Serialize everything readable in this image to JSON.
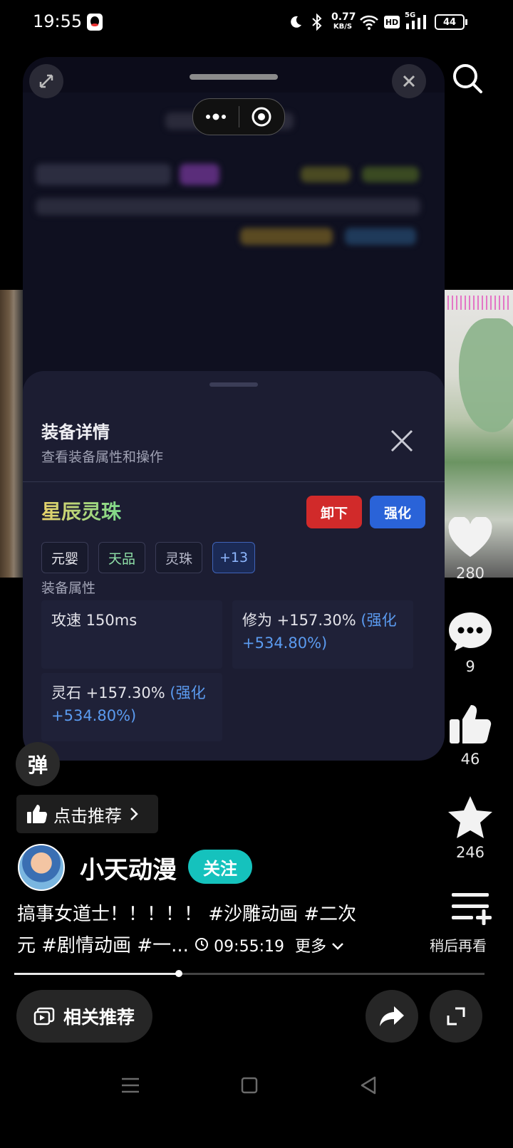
{
  "status_bar": {
    "time": "19:55",
    "network_speed_value": "0.77",
    "network_speed_unit": "KB/S",
    "hd_label": "HD",
    "cell_label": "5G",
    "battery": "44",
    "icons": [
      "qq-icon",
      "moon-icon",
      "bluetooth-icon",
      "wifi-icon",
      "hd-icon",
      "signal-icon",
      "battery-icon"
    ]
  },
  "mini_program": {
    "capsule_icons": [
      "more-dots-icon",
      "target-icon"
    ],
    "sheet": {
      "title": "装备详情",
      "subtitle": "查看装备属性和操作",
      "item_name": "星辰灵珠",
      "unequip_label": "卸下",
      "enhance_label": "强化",
      "tags": [
        {
          "text": "元婴",
          "color": "#e8e8ee"
        },
        {
          "text": "天品",
          "color": "#8fe0a8"
        },
        {
          "text": "灵珠",
          "color": "#b8bacb"
        },
        {
          "text": "+13",
          "color": "#8fb8ff"
        }
      ],
      "attributes_label": "装备属性",
      "attributes": [
        {
          "text": "攻速 150ms",
          "bonus": ""
        },
        {
          "text": "修为 +157.30%",
          "bonus": " (强化 +534.80%)"
        },
        {
          "text": "灵石 +157.30%",
          "bonus": " (强化 +534.80%)"
        }
      ]
    }
  },
  "right_rail": {
    "likes_heart": "280",
    "comments": "9",
    "thumbs": "46",
    "favorites": "246",
    "watch_later": "稍后再看"
  },
  "video_info": {
    "danmu_label": "弹",
    "recommend_label": "点击推荐",
    "author": "小天动漫",
    "follow_label": "关注",
    "description": "搞事女道士！！！！！ #沙雕动画 #二次元 #剧情动画 #一...",
    "timestamp": "09:55:19",
    "more_label": "更多",
    "progress_fraction": 0.35
  },
  "bottom_bar": {
    "related_label": "相关推荐"
  },
  "colors": {
    "accent_follow": "#15c2bd",
    "unequip_red": "#d12a2a",
    "enhance_blue": "#2a63d8",
    "bonus_blue": "#5b9bf0"
  }
}
